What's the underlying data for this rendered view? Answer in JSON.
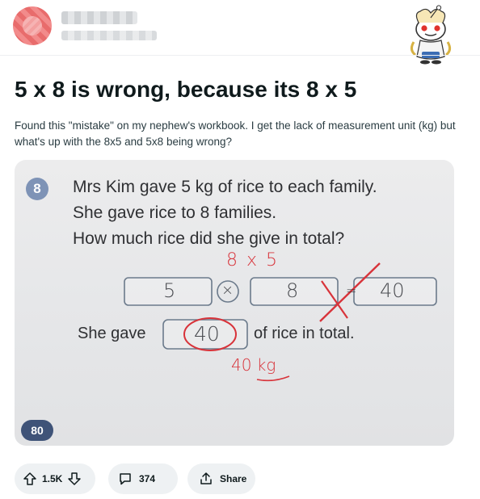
{
  "post": {
    "title": "5 x 8 is wrong, because its 8 x 5",
    "body": "Found this \"mistake\" on my nephew's workbook. I get the lack of measurement unit (kg) but what's up with the 8x5 and 5x8 being wrong?"
  },
  "image": {
    "question_number": "8",
    "line1": "Mrs Kim gave 5 kg of rice to each family.",
    "line2": "She gave rice to 8 families.",
    "line3": "How much rice did she give in total?",
    "teacher_note": "8 x 5",
    "box1": "5",
    "box2": "8",
    "box3": "40",
    "answer_prefix": "She gave",
    "answer_value": "40",
    "answer_suffix": "of rice in total.",
    "teacher_correction": "40 kg",
    "page_number": "80",
    "times_symbol": "×",
    "equals_symbol": "="
  },
  "actions": {
    "votes": "1.5K",
    "comments": "374",
    "share_label": "Share"
  },
  "colors": {
    "ink_red": "#d8333a",
    "badge_blue": "#7e93b6",
    "page_badge": "#3f5378",
    "pill_bg": "#eef1f3"
  },
  "icons": [
    "upvote-icon",
    "downvote-icon",
    "comment-icon",
    "share-icon"
  ]
}
